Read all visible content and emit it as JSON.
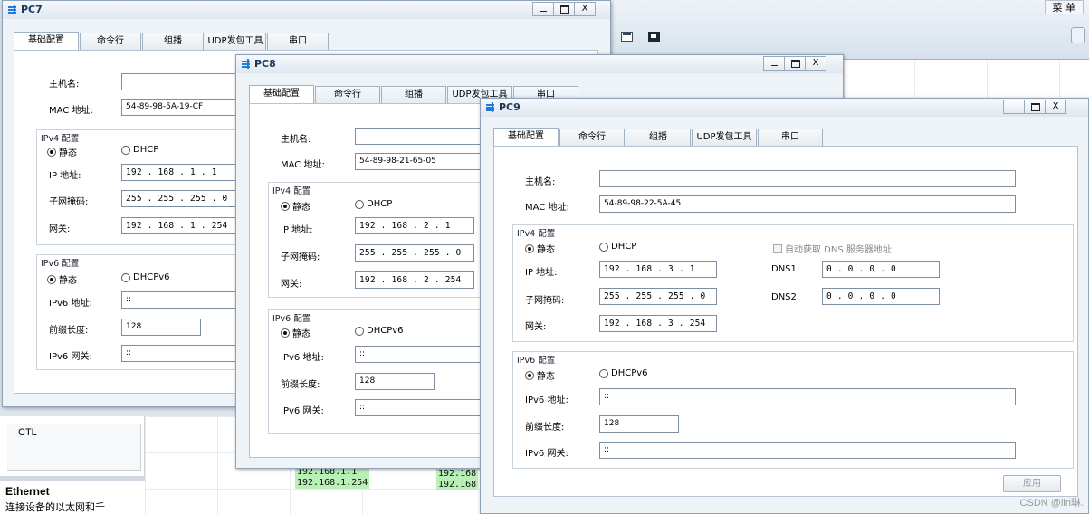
{
  "background": {
    "menu_label": "菜 单",
    "ctl_label": "CTL",
    "info_title": "Ethernet",
    "info_desc": "连接设备的以太网和千",
    "canvas_ip1": "192.168.1.1",
    "canvas_ip2": "192.168.1.254",
    "canvas_ip3": "192.168",
    "canvas_ip4": "192.168"
  },
  "tabs": [
    "基础配置",
    "命令行",
    "组播",
    "UDP发包工具",
    "串口"
  ],
  "labels": {
    "hostname": "主机名:",
    "mac": "MAC 地址:",
    "ipv4_group": "IPv4 配置",
    "static": "静态",
    "dhcp": "DHCP",
    "ip": "IP 地址:",
    "mask": "子网掩码:",
    "gateway": "网关:",
    "ipv6_group": "IPv6 配置",
    "dhcpv6": "DHCPv6",
    "ipv6_addr": "IPv6 地址:",
    "prefix": "前缀长度:",
    "ipv6_gw": "IPv6 网关:",
    "auto_dns": "自动获取 DNS 服务器地址",
    "dns1": "DNS1:",
    "dns2": "DNS2:",
    "apply": "应用"
  },
  "pc7": {
    "title": "PC7",
    "hostname": "",
    "mac": "54-89-98-5A-19-CF",
    "ip": "192 . 168 .  1  .  1",
    "mask": "255 . 255 . 255 .  0",
    "gateway": "192 . 168 .  1  . 254",
    "ipv6_addr": "::",
    "prefix": "128",
    "ipv6_gw": "::"
  },
  "pc8": {
    "title": "PC8",
    "hostname": "",
    "mac": "54-89-98-21-65-05",
    "ip": "192 . 168 .  2  .  1",
    "mask": "255 . 255 . 255 .  0",
    "gateway": "192 . 168 .  2  . 254",
    "ipv6_addr": "::",
    "prefix": "128",
    "ipv6_gw": "::"
  },
  "pc9": {
    "title": "PC9",
    "hostname": "",
    "mac": "54-89-98-22-5A-45",
    "ip": "192 . 168 .  3  .  1",
    "mask": "255 . 255 . 255 .  0",
    "gateway": "192 . 168 .  3  . 254",
    "dns1": "0  .  0  .  0  .  0",
    "dns2": "0  .  0  .  0  .  0",
    "ipv6_addr": "::",
    "prefix": "128",
    "ipv6_gw": "::"
  },
  "watermark": "CSDN @lin琳."
}
